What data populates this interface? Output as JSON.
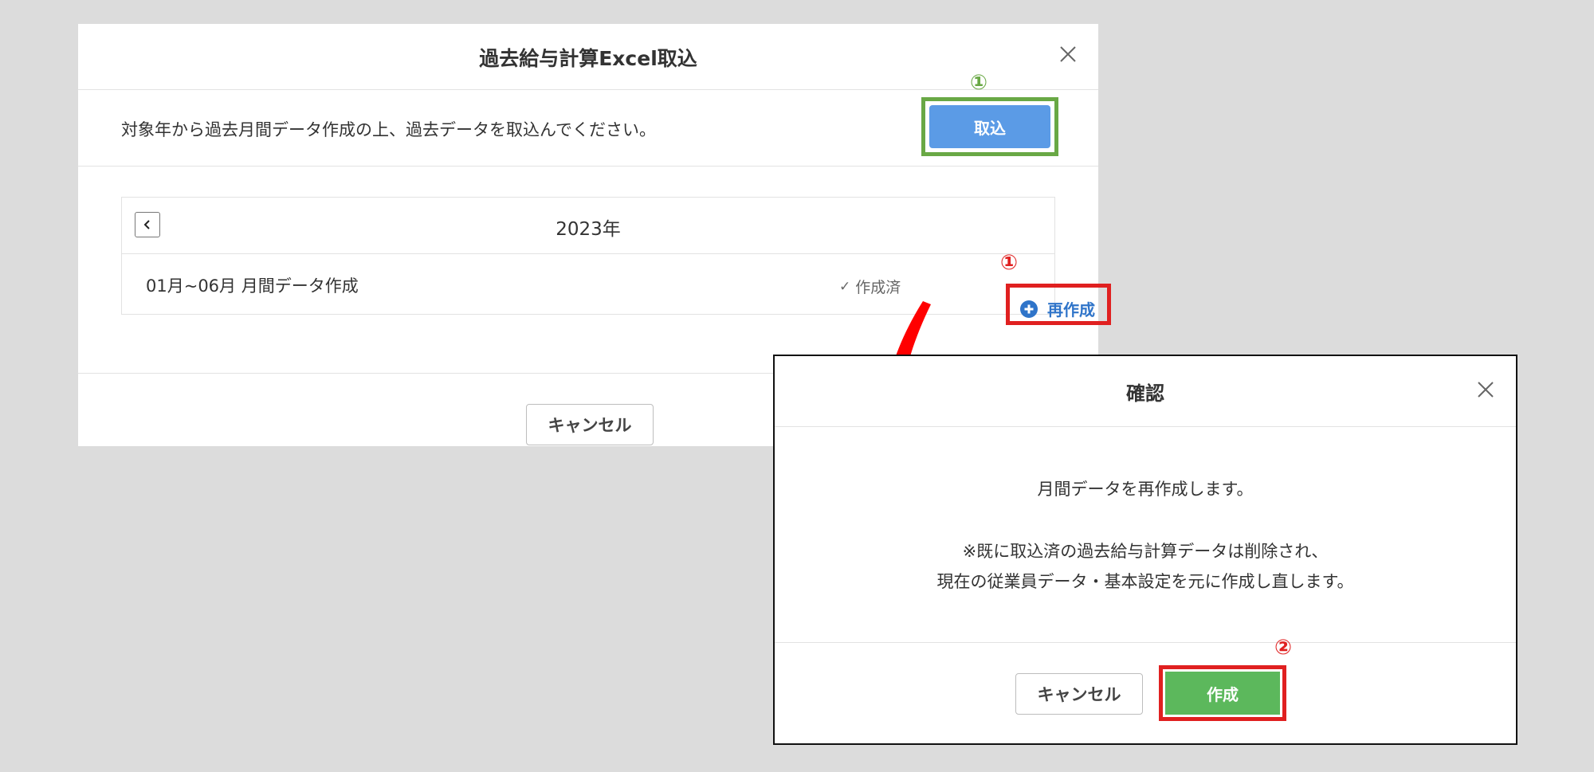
{
  "main_dialog": {
    "title": "過去給与計算Excel取込",
    "description": "対象年から過去月間データ作成の上、過去データを取込んでください。",
    "import_label": "取込",
    "year": "2023年",
    "month_row": {
      "label": "01月~06月 月間データ作成",
      "status": "作成済",
      "action": "再作成"
    },
    "cancel_label": "キャンセル"
  },
  "confirm_dialog": {
    "title": "確認",
    "message": "月間データを再作成します。",
    "note_line1": "※既に取込済の過去給与計算データは削除され、",
    "note_line2": "現在の従業員データ・基本設定を元に作成し直します。",
    "cancel_label": "キャンセル",
    "create_label": "作成"
  },
  "step_markers": {
    "import": "①",
    "recreate": "①",
    "create": "②"
  },
  "icons": {
    "close": "close-icon",
    "prev": "chevron-left-icon",
    "check": "check-icon",
    "plus": "plus-circle-icon"
  },
  "colors": {
    "backdrop": "#dcdcdc",
    "primary_blue": "#5b9be6",
    "link_blue": "#2f74c9",
    "create_green": "#5cb85c",
    "highlight_green": "#69a845",
    "highlight_red": "#e02020"
  }
}
